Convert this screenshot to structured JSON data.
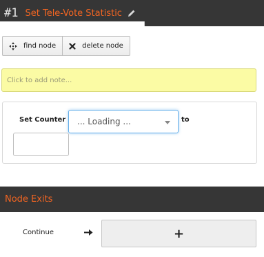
{
  "header": {
    "number": "#1",
    "title": "Set Tele-Vote Statistic",
    "edit_icon": "pencil-icon"
  },
  "toolbar": {
    "find_label": "find node",
    "find_icon": "crosshair-icon",
    "delete_label": "delete node",
    "delete_icon": "close-icon"
  },
  "note": {
    "placeholder": "Click to add note..."
  },
  "counter": {
    "label": "Set Counter",
    "select_value": "... Loading ...",
    "to_label": "to",
    "to_value": ""
  },
  "exits": {
    "title": "Node Exits",
    "items": [
      {
        "label": "Continue",
        "target_label": "+",
        "arrow_icon": "arrow-right-icon"
      }
    ]
  },
  "colors": {
    "header_bg": "#363636",
    "accent": "#f26522",
    "note_bg": "#fbfba4",
    "focus": "#66afe9"
  }
}
